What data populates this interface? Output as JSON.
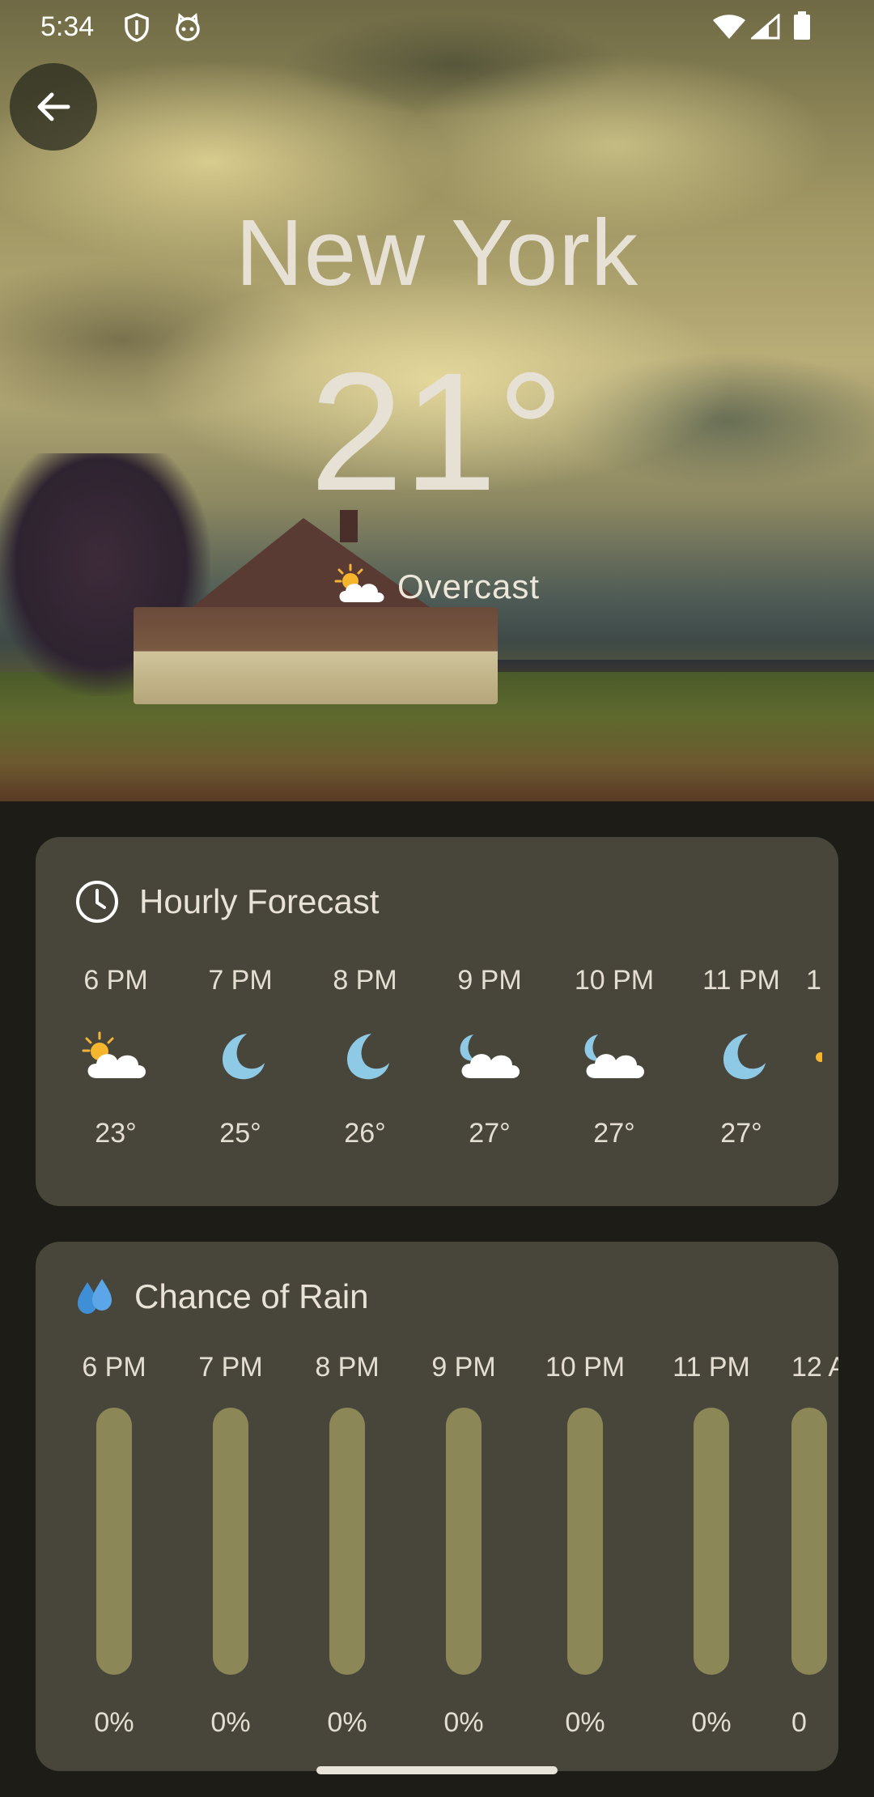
{
  "status_bar": {
    "time": "5:34"
  },
  "location": {
    "city": "New York",
    "temperature": "21°",
    "condition": "Overcast"
  },
  "hourly_forecast": {
    "title": "Hourly Forecast",
    "hours": [
      {
        "time": "6 PM",
        "icon": "sun-cloud",
        "temp": "23°"
      },
      {
        "time": "7 PM",
        "icon": "moon",
        "temp": "25°"
      },
      {
        "time": "8 PM",
        "icon": "moon",
        "temp": "26°"
      },
      {
        "time": "9 PM",
        "icon": "moon-cloud",
        "temp": "27°"
      },
      {
        "time": "10 PM",
        "icon": "moon-cloud",
        "temp": "27°"
      },
      {
        "time": "11 PM",
        "icon": "moon",
        "temp": "27°"
      },
      {
        "time": "1",
        "icon": "sun",
        "temp": ""
      }
    ]
  },
  "rain_chance": {
    "title": "Chance of Rain",
    "hours": [
      {
        "time": "6 PM",
        "value": "0%"
      },
      {
        "time": "7 PM",
        "value": "0%"
      },
      {
        "time": "8 PM",
        "value": "0%"
      },
      {
        "time": "9 PM",
        "value": "0%"
      },
      {
        "time": "10 PM",
        "value": "0%"
      },
      {
        "time": "11 PM",
        "value": "0%"
      },
      {
        "time": "12 A",
        "value": "0"
      }
    ]
  }
}
